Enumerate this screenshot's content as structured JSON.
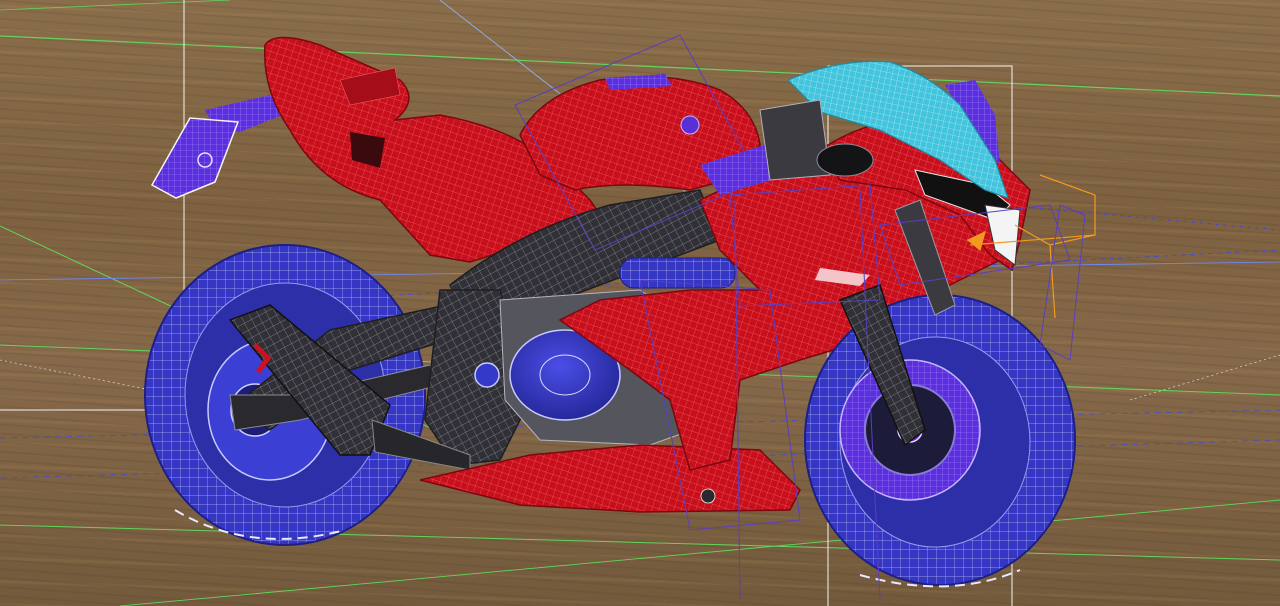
{
  "viewport": {
    "object": "sportbike-model",
    "render_mode": "wireframe-on-shaded",
    "background": "wood-texture"
  },
  "colors": {
    "body_red": "#d0101e",
    "body_red_dark": "#8e0a14",
    "wire_red": "#f04a55",
    "frame_dark": "#2e2e32",
    "frame_wire": "#9a9aa4",
    "tire_blue": "#3a3ccf",
    "tire_wire": "#a8aaf0",
    "rim_purple": "#6a2ee0",
    "windshield_cyan": "#45c6dc",
    "accent_violet": "#5a2fd6",
    "grid_green": "#5fd35a",
    "grid_blue": "#2a3ce0",
    "bbox_white": "#f2f2f2",
    "light_orange": "#f29a20"
  },
  "icons": {
    "tail-light": "light-icon",
    "spot-light": "light-icon"
  }
}
